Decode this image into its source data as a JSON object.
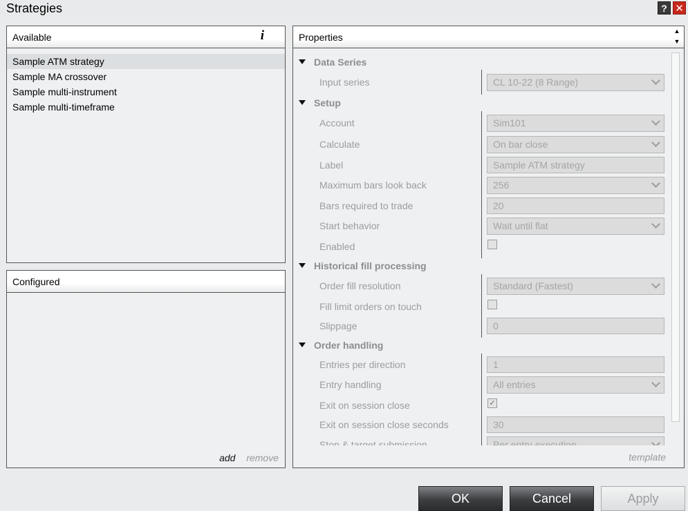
{
  "window": {
    "title": "Strategies",
    "help_glyph": "?",
    "close_glyph": "✕"
  },
  "available": {
    "header": "Available",
    "info_glyph": "i",
    "items": [
      "Sample ATM strategy",
      "Sample MA crossover",
      "Sample multi-instrument",
      "Sample multi-timeframe"
    ],
    "selected_index": 0
  },
  "configured": {
    "header": "Configured",
    "add": "add",
    "remove": "remove"
  },
  "properties": {
    "header": "Properties",
    "template": "template",
    "categories": {
      "data_series": "Data Series",
      "setup": "Setup",
      "historical": "Historical fill processing",
      "order_handling": "Order handling"
    },
    "rows": {
      "input_series": {
        "label": "Input series",
        "value": "CL 10-22 (8 Range)"
      },
      "account": {
        "label": "Account",
        "value": "Sim101"
      },
      "calculate": {
        "label": "Calculate",
        "value": "On bar close"
      },
      "label": {
        "label": "Label",
        "value": "Sample ATM strategy"
      },
      "max_bars": {
        "label": "Maximum bars look back",
        "value": "256"
      },
      "bars_required": {
        "label": "Bars required to trade",
        "value": "20"
      },
      "start_behavior": {
        "label": "Start behavior",
        "value": "Wait until flat"
      },
      "enabled": {
        "label": "Enabled",
        "checked": false
      },
      "order_fill_resolution": {
        "label": "Order fill resolution",
        "value": "Standard (Fastest)"
      },
      "fill_limit": {
        "label": "Fill limit orders on touch",
        "checked": false
      },
      "slippage": {
        "label": "Slippage",
        "value": "0"
      },
      "entries_per_direction": {
        "label": "Entries per direction",
        "value": "1"
      },
      "entry_handling": {
        "label": "Entry handling",
        "value": "All entries"
      },
      "exit_on_close": {
        "label": "Exit on session close",
        "checked": true,
        "check_glyph": "✓"
      },
      "exit_on_close_seconds": {
        "label": "Exit on session close seconds",
        "value": "30"
      },
      "stop_target": {
        "label": "Stop & target submission",
        "value": "Per entry execution"
      }
    }
  },
  "buttons": {
    "ok": "OK",
    "cancel": "Cancel",
    "apply": "Apply"
  }
}
